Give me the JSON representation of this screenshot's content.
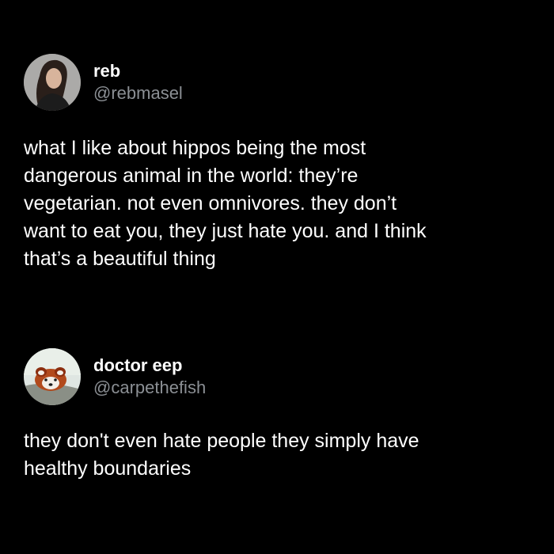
{
  "colors": {
    "background": "#000000",
    "text": "#ffffff",
    "handle": "#8b8f94"
  },
  "posts": [
    {
      "display_name": "reb",
      "handle": "@rebmasel",
      "avatar_icon": "user-photo-avatar",
      "text": "what I like about hippos being the most\ndangerous animal in the world: they’re\nvegetarian. not even omnivores. they don’t\nwant to eat you, they just hate you. and I think\nthat’s a beautiful thing"
    },
    {
      "display_name": "doctor eep",
      "handle": "@carpethefish",
      "avatar_icon": "red-panda-avatar",
      "text": "they don't even hate people they simply have\nhealthy boundaries"
    }
  ]
}
